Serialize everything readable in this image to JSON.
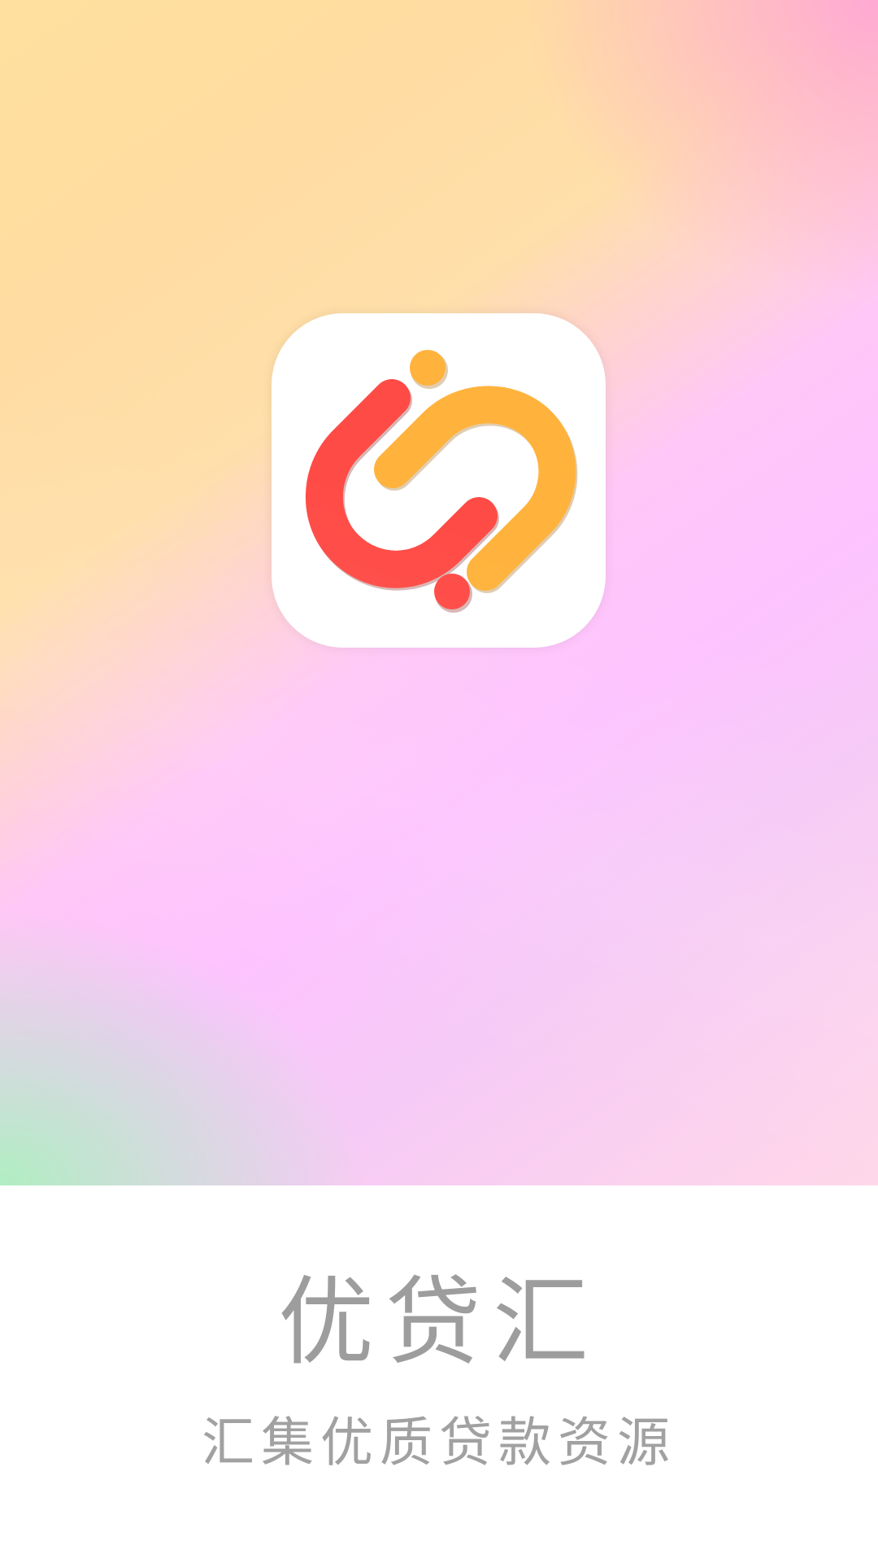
{
  "app": {
    "name": "优贷汇",
    "slogan": "汇集优质贷款资源"
  },
  "colors": {
    "background_top_left": "#ffe09e",
    "background_mid": "#fdc3ff",
    "background_bottom_left": "#b0eec2",
    "background_top_right": "#ffa6d6",
    "logo_red": "#ff4b46",
    "logo_orange": "#ffb33d",
    "text_gray": "#9d9d9d",
    "white": "#ffffff"
  },
  "icons": {
    "app_logo": "chain-link-logo-icon"
  }
}
